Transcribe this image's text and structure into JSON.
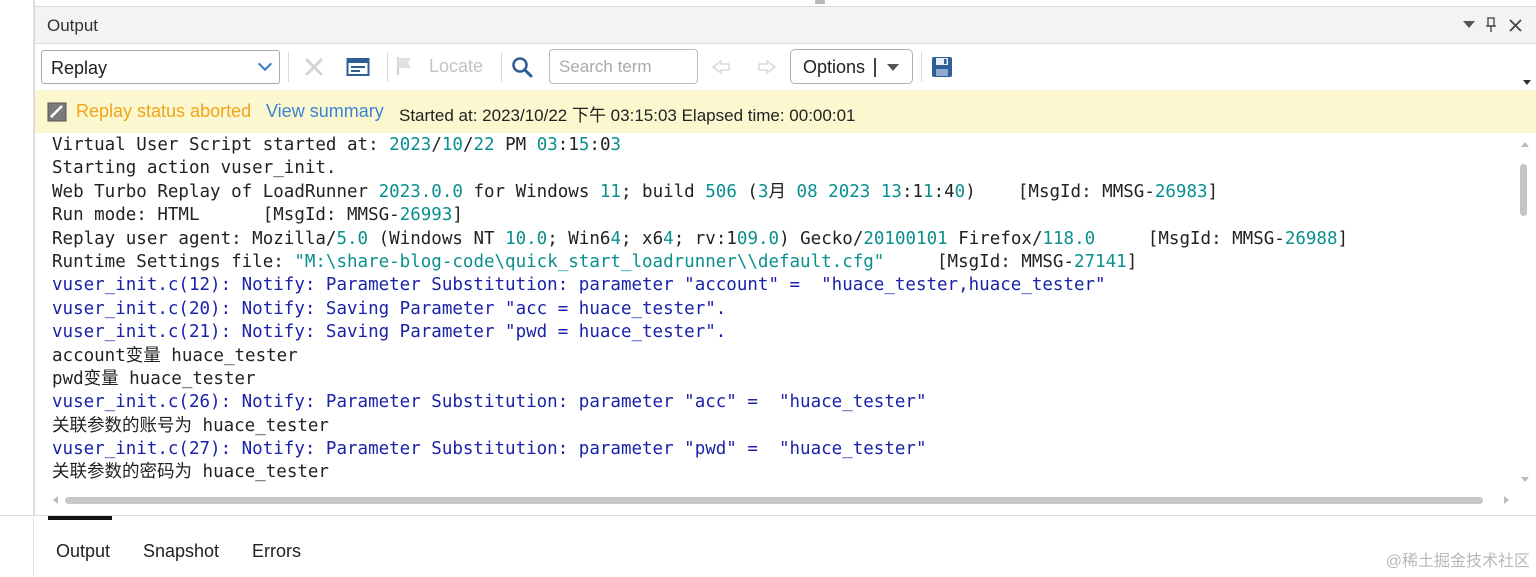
{
  "panel": {
    "title": "Output"
  },
  "toolbar": {
    "mode_select": "Replay",
    "locate_label": "Locate",
    "search_placeholder": "Search term",
    "options_label": "Options"
  },
  "status": {
    "aborted_text": "Replay status aborted",
    "summary_link": "View summary",
    "started_text": "Started at: 2023/10/22 下午 03:15:03 Elapsed time: 00:00:01"
  },
  "log_lines": [
    {
      "text": "Virtual User Script started at: 2023/10/22 PM 03:15:03",
      "kind": "normal"
    },
    {
      "text": "Starting action vuser_init.",
      "kind": "normal"
    },
    {
      "text": "Web Turbo Replay of LoadRunner 2023.0.0 for Windows 11; build 506 (3月 08 2023 13:11:40)    [MsgId: MMSG-26983]",
      "kind": "normal"
    },
    {
      "text": "Run mode: HTML      [MsgId: MMSG-26993]",
      "kind": "normal"
    },
    {
      "text": "Replay user agent: Mozilla/5.0 (Windows NT 10.0; Win64; x64; rv:109.0) Gecko/20100101 Firefox/118.0     [MsgId: MMSG-26988]",
      "kind": "normal"
    },
    {
      "text": "Runtime Settings file: \"M:\\share-blog-code\\quick_start_loadrunner\\\\default.cfg\"     [MsgId: MMSG-27141]",
      "kind": "normal"
    },
    {
      "text": "vuser_init.c(12): Notify: Parameter Substitution: parameter \"account\" =  \"huace_tester,huace_tester\"",
      "kind": "notify"
    },
    {
      "text": "vuser_init.c(20): Notify: Saving Parameter \"acc = huace_tester\".",
      "kind": "notify"
    },
    {
      "text": "vuser_init.c(21): Notify: Saving Parameter \"pwd = huace_tester\".",
      "kind": "notify"
    },
    {
      "text": "account变量 huace_tester",
      "kind": "normal"
    },
    {
      "text": "pwd变量 huace_tester",
      "kind": "normal"
    },
    {
      "text": "vuser_init.c(26): Notify: Parameter Substitution: parameter \"acc\" =  \"huace_tester\"",
      "kind": "notify"
    },
    {
      "text": "关联参数的账号为 huace_tester",
      "kind": "normal"
    },
    {
      "text": "vuser_init.c(27): Notify: Parameter Substitution: parameter \"pwd\" =  \"huace_tester\"",
      "kind": "notify"
    },
    {
      "text": "关联参数的密码为 huace_tester",
      "kind": "normal"
    }
  ],
  "tabs": [
    {
      "label": "Output",
      "active": true
    },
    {
      "label": "Snapshot",
      "active": false
    },
    {
      "label": "Errors",
      "active": false
    }
  ],
  "watermark": "@稀土掘金技术社区",
  "colors": {
    "status_bg": "#fbf8cf",
    "aborted": "#f0a418",
    "link": "#3b82d4",
    "notify": "#1a22a8",
    "number": "#0a8f8f"
  },
  "icons": [
    "dropdown-chevron-icon",
    "clear-icon",
    "replay-log-icon",
    "locate-flag-icon",
    "search-icon",
    "prev-match-icon",
    "next-match-icon",
    "save-icon",
    "status-aborted-icon",
    "pin-icon",
    "close-icon"
  ]
}
